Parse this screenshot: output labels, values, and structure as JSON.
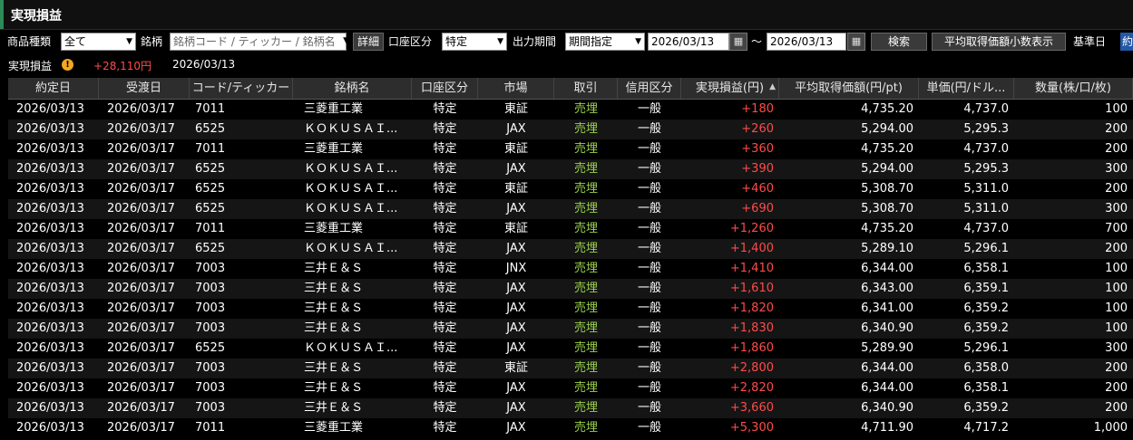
{
  "title": "実現損益",
  "filters": {
    "product_type_label": "商品種類",
    "product_type_value": "全て",
    "brand_label": "銘柄",
    "brand_placeholder": "銘柄コード / ティッカー / 銘柄名",
    "detail_button": "詳細",
    "account_label": "口座区分",
    "account_value": "特定",
    "period_label": "出力期間",
    "period_value": "期間指定",
    "date_from": "2026/03/13",
    "tilde": "～",
    "date_to": "2026/03/13",
    "search_button": "検索",
    "avg_decimal_button": "平均取得価額小数表示",
    "base_date_label": "基準日",
    "base_date_cut": "約"
  },
  "summary": {
    "label": "実現損益",
    "icon": "!",
    "total": "+28,110円",
    "date": "2026/03/13"
  },
  "columns": [
    "約定日",
    "受渡日",
    "コード/ティッカー",
    "銘柄名",
    "口座区分",
    "市場",
    "取引",
    "信用区分",
    "実現損益(円)",
    "平均取得価額(円/pt)",
    "単価(円/ドル...",
    "数量(株/口/枚)"
  ],
  "rows": [
    [
      "2026/03/13",
      "2026/03/17",
      "7011",
      "三菱重工業",
      "特定",
      "東証",
      "売埋",
      "一般",
      "+180",
      "4,735.20",
      "4,737.0",
      "100"
    ],
    [
      "2026/03/13",
      "2026/03/17",
      "6525",
      "ＫＯＫＵＳＡＩ...",
      "特定",
      "JAX",
      "売埋",
      "一般",
      "+260",
      "5,294.00",
      "5,295.3",
      "200"
    ],
    [
      "2026/03/13",
      "2026/03/17",
      "7011",
      "三菱重工業",
      "特定",
      "東証",
      "売埋",
      "一般",
      "+360",
      "4,735.20",
      "4,737.0",
      "200"
    ],
    [
      "2026/03/13",
      "2026/03/17",
      "6525",
      "ＫＯＫＵＳＡＩ...",
      "特定",
      "JAX",
      "売埋",
      "一般",
      "+390",
      "5,294.00",
      "5,295.3",
      "300"
    ],
    [
      "2026/03/13",
      "2026/03/17",
      "6525",
      "ＫＯＫＵＳＡＩ...",
      "特定",
      "東証",
      "売埋",
      "一般",
      "+460",
      "5,308.70",
      "5,311.0",
      "200"
    ],
    [
      "2026/03/13",
      "2026/03/17",
      "6525",
      "ＫＯＫＵＳＡＩ...",
      "特定",
      "JAX",
      "売埋",
      "一般",
      "+690",
      "5,308.70",
      "5,311.0",
      "300"
    ],
    [
      "2026/03/13",
      "2026/03/17",
      "7011",
      "三菱重工業",
      "特定",
      "東証",
      "売埋",
      "一般",
      "+1,260",
      "4,735.20",
      "4,737.0",
      "700"
    ],
    [
      "2026/03/13",
      "2026/03/17",
      "6525",
      "ＫＯＫＵＳＡＩ...",
      "特定",
      "JAX",
      "売埋",
      "一般",
      "+1,400",
      "5,289.10",
      "5,296.1",
      "200"
    ],
    [
      "2026/03/13",
      "2026/03/17",
      "7003",
      "三井Ｅ＆Ｓ",
      "特定",
      "JNX",
      "売埋",
      "一般",
      "+1,410",
      "6,344.00",
      "6,358.1",
      "100"
    ],
    [
      "2026/03/13",
      "2026/03/17",
      "7003",
      "三井Ｅ＆Ｓ",
      "特定",
      "JAX",
      "売埋",
      "一般",
      "+1,610",
      "6,343.00",
      "6,359.1",
      "100"
    ],
    [
      "2026/03/13",
      "2026/03/17",
      "7003",
      "三井Ｅ＆Ｓ",
      "特定",
      "JAX",
      "売埋",
      "一般",
      "+1,820",
      "6,341.00",
      "6,359.2",
      "100"
    ],
    [
      "2026/03/13",
      "2026/03/17",
      "7003",
      "三井Ｅ＆Ｓ",
      "特定",
      "JAX",
      "売埋",
      "一般",
      "+1,830",
      "6,340.90",
      "6,359.2",
      "100"
    ],
    [
      "2026/03/13",
      "2026/03/17",
      "6525",
      "ＫＯＫＵＳＡＩ...",
      "特定",
      "JAX",
      "売埋",
      "一般",
      "+1,860",
      "5,289.90",
      "5,296.1",
      "300"
    ],
    [
      "2026/03/13",
      "2026/03/17",
      "7003",
      "三井Ｅ＆Ｓ",
      "特定",
      "東証",
      "売埋",
      "一般",
      "+2,800",
      "6,344.00",
      "6,358.0",
      "200"
    ],
    [
      "2026/03/13",
      "2026/03/17",
      "7003",
      "三井Ｅ＆Ｓ",
      "特定",
      "JAX",
      "売埋",
      "一般",
      "+2,820",
      "6,344.00",
      "6,358.1",
      "200"
    ],
    [
      "2026/03/13",
      "2026/03/17",
      "7003",
      "三井Ｅ＆Ｓ",
      "特定",
      "JAX",
      "売埋",
      "一般",
      "+3,660",
      "6,340.90",
      "6,359.2",
      "200"
    ],
    [
      "2026/03/13",
      "2026/03/17",
      "7011",
      "三菱重工業",
      "特定",
      "JAX",
      "売埋",
      "一般",
      "+5,300",
      "4,711.90",
      "4,717.2",
      "1,000"
    ]
  ],
  "colors": {
    "profit": "#ff4a4a",
    "trade": "#9ad14b",
    "accent": "#2e8b57"
  }
}
